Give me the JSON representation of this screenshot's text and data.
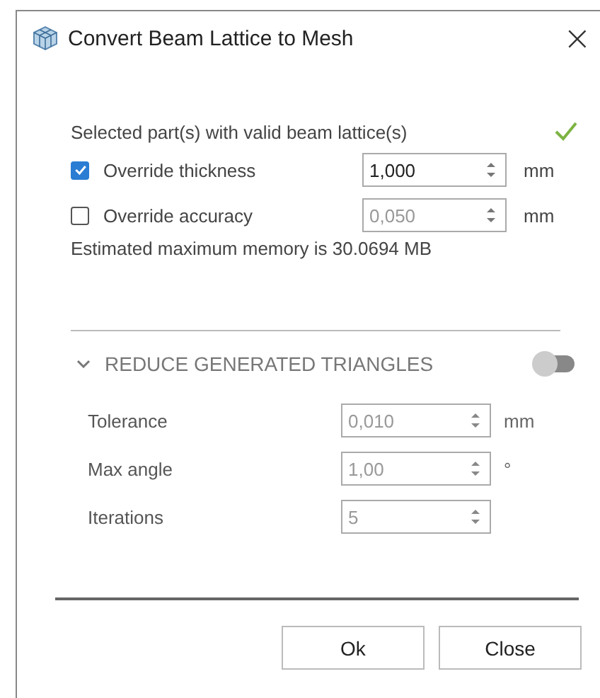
{
  "window": {
    "title": "Convert Beam Lattice to Mesh",
    "close": "×"
  },
  "status": {
    "text": "Selected part(s) with valid beam lattice(s)",
    "valid": true
  },
  "overrides": [
    {
      "label": "Override thickness",
      "checked": true,
      "value": "1,000",
      "unit": "mm"
    },
    {
      "label": "Override accuracy",
      "checked": false,
      "value": "0,050",
      "unit": "mm"
    }
  ],
  "memory": "Estimated maximum memory is 30.0694 MB",
  "section": {
    "title": "REDUCE GENERATED TRIANGLES",
    "expanded": true,
    "on": false,
    "fields": [
      {
        "label": "Tolerance",
        "value": "0,010",
        "unit": "mm"
      },
      {
        "label": "Max angle",
        "value": "1,00",
        "unit": "°"
      },
      {
        "label": "Iterations",
        "value": "5"
      }
    ]
  },
  "buttons": [
    "Ok",
    "Close"
  ]
}
